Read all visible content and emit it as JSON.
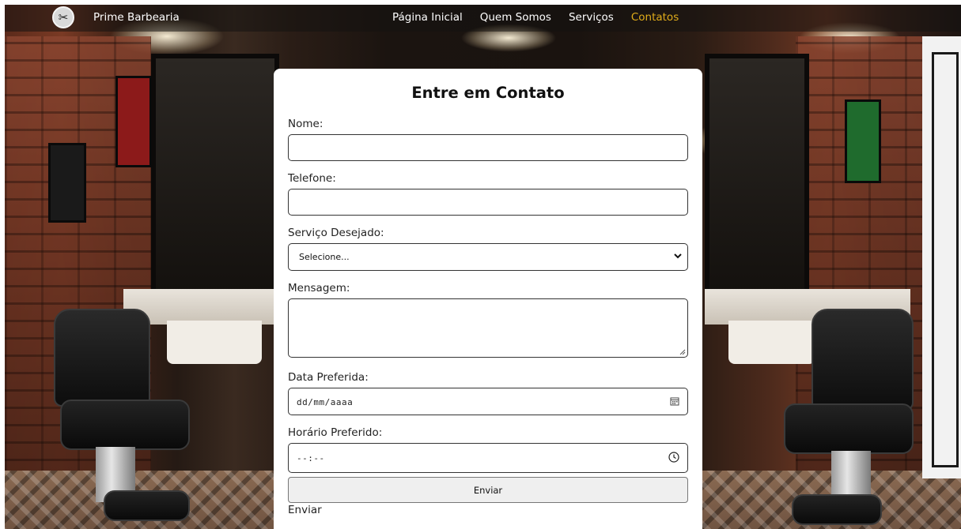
{
  "brand": {
    "name": "Prime Barbearia"
  },
  "nav": {
    "items": [
      {
        "label": "Página Inicial",
        "active": false
      },
      {
        "label": "Quem Somos",
        "active": false
      },
      {
        "label": "Serviços",
        "active": false
      },
      {
        "label": "Contatos",
        "active": true
      }
    ],
    "active_color": "#e0ac1a"
  },
  "form": {
    "title": "Entre em Contato",
    "name": {
      "label": "Nome:",
      "value": ""
    },
    "phone": {
      "label": "Telefone:",
      "value": ""
    },
    "service": {
      "label": "Serviço Desejado:",
      "selected": "Selecione..."
    },
    "message": {
      "label": "Mensagem:",
      "value": ""
    },
    "date": {
      "label": "Data Preferida:",
      "placeholder": "dd/mm/aaaa",
      "icon": "calendar-icon"
    },
    "time": {
      "label": "Horário Preferido:",
      "placeholder": "--:--",
      "icon": "clock-icon"
    },
    "submit_label": "Enviar",
    "footer_text": "Enviar"
  }
}
